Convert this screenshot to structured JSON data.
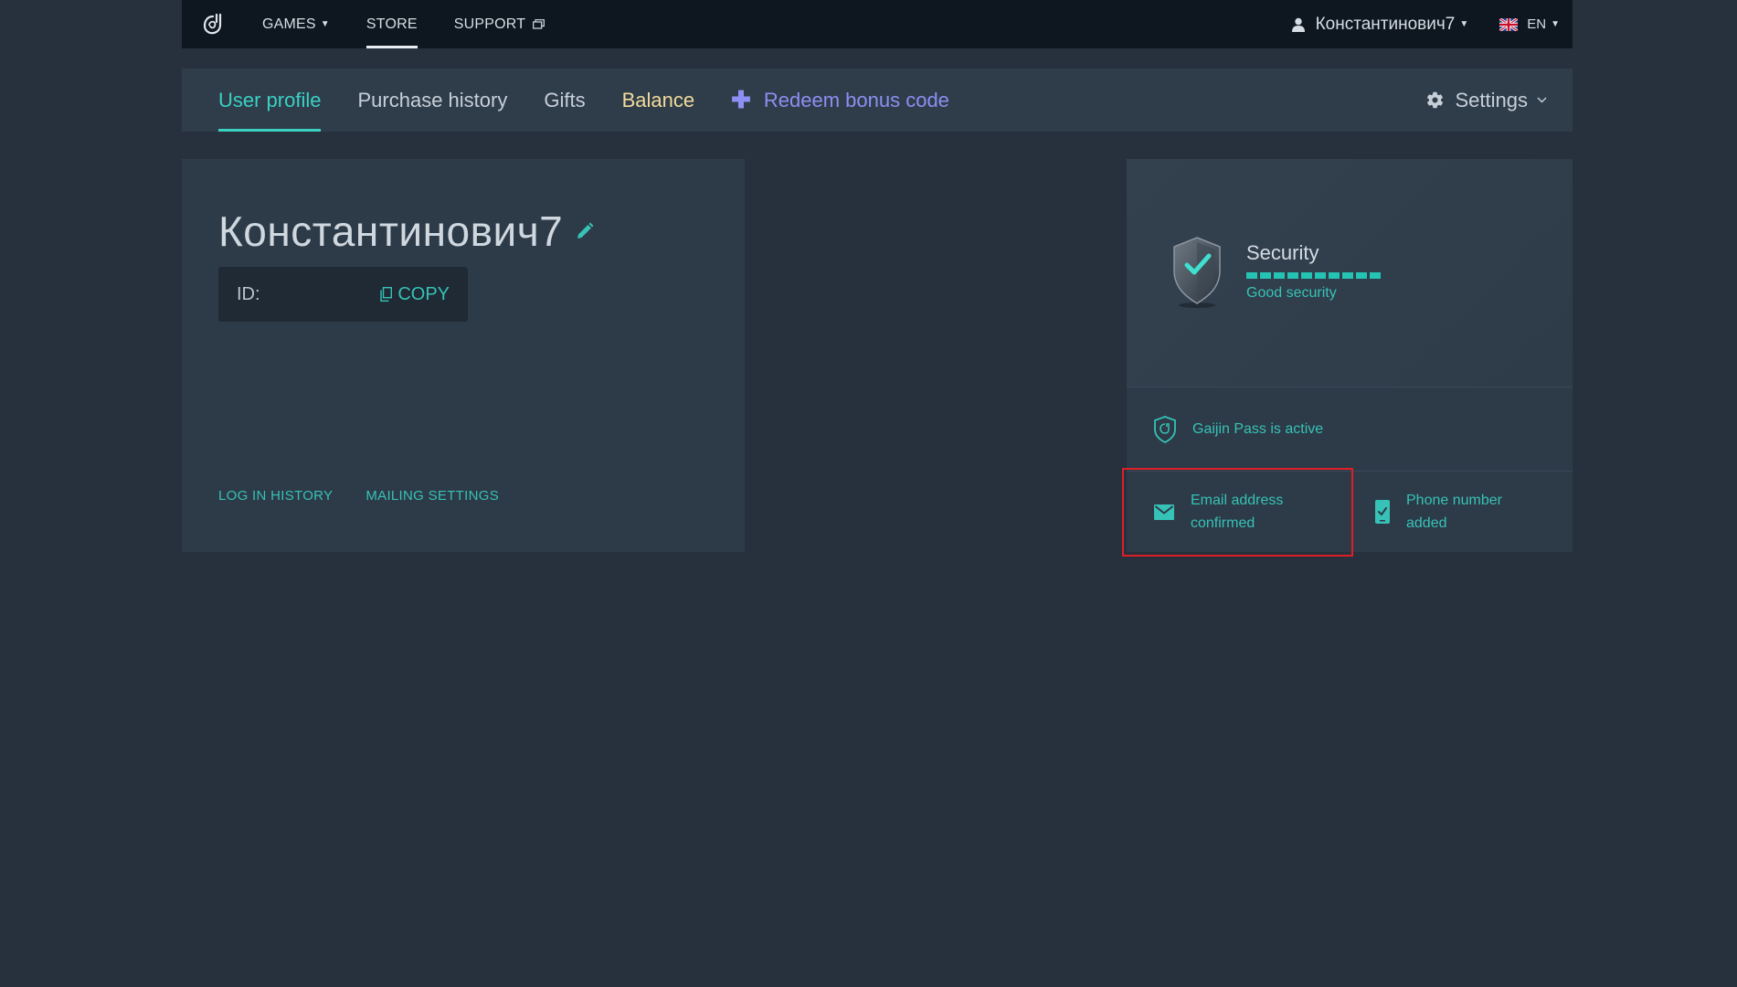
{
  "topnav": {
    "games": "GAMES",
    "store": "STORE",
    "support": "SUPPORT",
    "username": "Константинович7",
    "language": "EN"
  },
  "tabs": {
    "user_profile": "User profile",
    "purchase_history": "Purchase history",
    "gifts": "Gifts",
    "balance": "Balance",
    "redeem": "Redeem bonus code",
    "settings": "Settings"
  },
  "profile": {
    "username": "Константинович7",
    "id_label": "ID:",
    "copy_label": "COPY",
    "links": {
      "login_history": "LOG IN HISTORY",
      "mailing_settings": "MAILING SETTINGS"
    }
  },
  "security": {
    "title": "Security",
    "status": "Good security",
    "level_segments_filled": 10,
    "level_segments_total": 10,
    "gaijin_pass": "Gaijin Pass is active",
    "email": "Email address confirmed",
    "phone": "Phone number added"
  },
  "colors": {
    "background": "#27313d",
    "topnav": "#0e1720",
    "card": "#2d3a48",
    "accent": "#36c2b6",
    "balance": "#f2dc9b",
    "redeem": "#8d8ff2",
    "highlight": "#e01e25"
  },
  "icons": [
    "gaijin-logo-icon",
    "external-link-icon",
    "user-icon",
    "uk-flag-icon",
    "plus-icon",
    "gear-icon",
    "chevron-down-icon",
    "pencil-icon",
    "copy-icon",
    "shield-check-icon",
    "gaijin-pass-icon",
    "envelope-icon",
    "phone-check-icon"
  ]
}
